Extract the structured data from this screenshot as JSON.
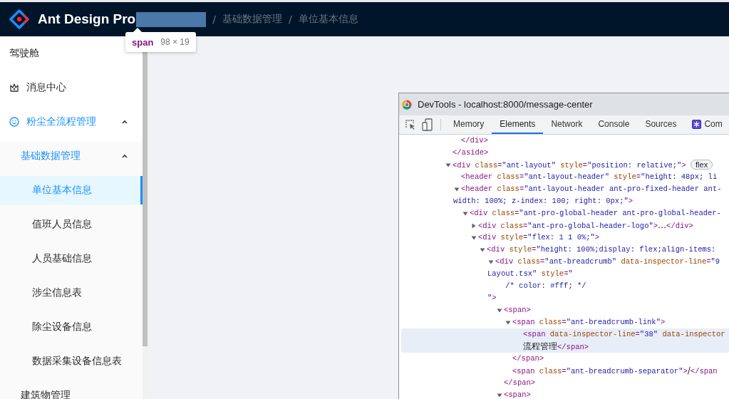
{
  "header": {
    "title": "Ant Design Pro",
    "breadcrumb": [
      {
        "label": "基础数据管理"
      },
      {
        "label": "单位基本信息"
      }
    ],
    "separator": "/"
  },
  "inspector_tooltip": {
    "tag": "span",
    "size": "98 × 19"
  },
  "sidebar": {
    "items": [
      {
        "label": "驾驶舱",
        "selected": false
      },
      {
        "label": "消息中心",
        "selected": false
      },
      {
        "label": "粉尘全流程管理",
        "expanded": true,
        "selected": false,
        "children": [
          {
            "label": "基础数据管理",
            "expanded": true,
            "selected": false,
            "children": [
              {
                "label": "单位基本信息",
                "selected": true
              },
              {
                "label": "值班人员信息",
                "selected": false
              },
              {
                "label": "人员基础信息",
                "selected": false
              },
              {
                "label": "涉尘信息表",
                "selected": false
              },
              {
                "label": "除尘设备信息",
                "selected": false
              },
              {
                "label": "数据采集设备信息表",
                "selected": false
              }
            ]
          },
          {
            "label": "建筑物管理",
            "selected": false
          }
        ]
      }
    ]
  },
  "devtools": {
    "title": "DevTools - localhost:8000/message-center",
    "tabs": [
      {
        "label": "Memory",
        "selected": false
      },
      {
        "label": "Elements",
        "selected": true
      },
      {
        "label": "Network",
        "selected": false
      },
      {
        "label": "Console",
        "selected": false
      },
      {
        "label": "Sources",
        "selected": false
      },
      {
        "label": "Com",
        "kind": "extension",
        "selected": false
      }
    ],
    "tree": [
      {
        "children": [
          {
            "close": [
              {
                "kind": "tag",
                "text": "</div>"
              }
            ]
          }
        ],
        "close": [
          {
            "kind": "tag",
            "text": "</aside>"
          }
        ]
      },
      {
        "open": [
          {
            "kind": "tag",
            "text": "<div"
          },
          {
            "kind": "attr",
            "text": " class"
          },
          {
            "kind": "tag",
            "text": "="
          },
          {
            "kind": "value",
            "text": "\"ant-layout\""
          },
          {
            "kind": "attr",
            "text": " style"
          },
          {
            "kind": "tag",
            "text": "="
          },
          {
            "kind": "value",
            "text": "\"position: relative;\""
          },
          {
            "kind": "tag",
            "text": ">"
          }
        ],
        "badge": "flex",
        "expanded": true,
        "children": [
          {
            "open": [
              {
                "kind": "tag",
                "text": "<header"
              },
              {
                "kind": "attr",
                "text": " class"
              },
              {
                "kind": "tag",
                "text": "="
              },
              {
                "kind": "value",
                "text": "\"ant-layout-header\""
              },
              {
                "kind": "attr",
                "text": " style"
              },
              {
                "kind": "tag",
                "text": "="
              },
              {
                "kind": "value",
                "text": "\"height: 48px; li"
              }
            ]
          },
          {
            "open": [
              {
                "kind": "tag",
                "text": "<header"
              },
              {
                "kind": "attr",
                "text": " class"
              },
              {
                "kind": "tag",
                "text": "="
              },
              {
                "kind": "value",
                "text": "\"ant-layout-header ant-pro-fixed-header ant-"
              }
            ],
            "wrap": [
              [
                {
                  "kind": "value",
                  "text": "width: 100%; z-index: 100; right: 0px;\""
                },
                {
                  "kind": "tag",
                  "text": ">"
                }
              ]
            ],
            "expanded": true,
            "children": [
              {
                "open": [
                  {
                    "kind": "tag",
                    "text": "<div"
                  },
                  {
                    "kind": "attr",
                    "text": " class"
                  },
                  {
                    "kind": "tag",
                    "text": "="
                  },
                  {
                    "kind": "value",
                    "text": "\"ant-pro-global-header ant-pro-global-header-"
                  }
                ],
                "expanded": true,
                "children": [
                  {
                    "open": [
                      {
                        "kind": "tag",
                        "text": "<div"
                      },
                      {
                        "kind": "attr",
                        "text": " class"
                      },
                      {
                        "kind": "tag",
                        "text": "="
                      },
                      {
                        "kind": "value",
                        "text": "\"ant-pro-global-header-logo\""
                      },
                      {
                        "kind": "tag",
                        "text": ">"
                      },
                      {
                        "kind": "text",
                        "text": "…"
                      },
                      {
                        "kind": "tag",
                        "text": "</div>"
                      }
                    ],
                    "expanded": false
                  },
                  {
                    "open": [
                      {
                        "kind": "tag",
                        "text": "<div"
                      },
                      {
                        "kind": "attr",
                        "text": " style"
                      },
                      {
                        "kind": "tag",
                        "text": "="
                      },
                      {
                        "kind": "value",
                        "text": "\"flex: 1 1 0%;\""
                      },
                      {
                        "kind": "tag",
                        "text": ">"
                      }
                    ],
                    "expanded": true,
                    "children": [
                      {
                        "open": [
                          {
                            "kind": "tag",
                            "text": "<div"
                          },
                          {
                            "kind": "attr",
                            "text": " style"
                          },
                          {
                            "kind": "tag",
                            "text": "="
                          },
                          {
                            "kind": "value",
                            "text": "\"height: 100%;display: flex;align-items:"
                          }
                        ],
                        "expanded": true,
                        "children": [
                          {
                            "open": [
                              {
                                "kind": "tag",
                                "text": "<div"
                              },
                              {
                                "kind": "attr",
                                "text": " class"
                              },
                              {
                                "kind": "tag",
                                "text": "="
                              },
                              {
                                "kind": "value",
                                "text": "\"ant-breadcrumb\""
                              },
                              {
                                "kind": "attr",
                                "text": " data-inspector-line"
                              },
                              {
                                "kind": "tag",
                                "text": "="
                              },
                              {
                                "kind": "value",
                                "text": "\"9"
                              }
                            ],
                            "wrap": [
                              [
                                {
                                  "kind": "value",
                                  "text": "Layout.tsx\""
                                },
                                {
                                  "kind": "attr",
                                  "text": " style"
                                },
                                {
                                  "kind": "tag",
                                  "text": "="
                                },
                                {
                                  "kind": "value",
                                  "text": "\""
                                }
                              ],
                              [
                                {
                                  "kind": "value",
                                  "text": "    /* color: #fff; */"
                                }
                              ],
                              [
                                {
                                  "kind": "value",
                                  "text": "\""
                                },
                                {
                                  "kind": "tag",
                                  "text": ">"
                                }
                              ]
                            ],
                            "expanded": true,
                            "children": [
                              {
                                "open": [
                                  {
                                    "kind": "tag",
                                    "text": "<span>"
                                  }
                                ],
                                "expanded": true,
                                "children": [
                                  {
                                    "open": [
                                      {
                                        "kind": "tag",
                                        "text": "<span"
                                      },
                                      {
                                        "kind": "attr",
                                        "text": " class"
                                      },
                                      {
                                        "kind": "tag",
                                        "text": "="
                                      },
                                      {
                                        "kind": "value",
                                        "text": "\"ant-breadcrumb-link\""
                                      },
                                      {
                                        "kind": "tag",
                                        "text": ">"
                                      }
                                    ],
                                    "expanded": true,
                                    "children": [
                                      {
                                        "open": [
                                          {
                                            "kind": "tag",
                                            "text": "<span"
                                          },
                                          {
                                            "kind": "attr",
                                            "text": " data-inspector-line"
                                          },
                                          {
                                            "kind": "tag",
                                            "text": "="
                                          },
                                          {
                                            "kind": "value",
                                            "text": "\"38\""
                                          },
                                          {
                                            "kind": "attr",
                                            "text": " data-inspector"
                                          }
                                        ],
                                        "wrap": [
                                          [
                                            {
                                              "kind": "text",
                                              "text": "流程管理"
                                            },
                                            {
                                              "kind": "tag",
                                              "text": "</span>"
                                            }
                                          ]
                                        ],
                                        "selected": true
                                      }
                                    ],
                                    "close": [
                                      {
                                        "kind": "tag",
                                        "text": "</span>"
                                      }
                                    ]
                                  },
                                  {
                                    "open": [
                                      {
                                        "kind": "tag",
                                        "text": "<span"
                                      },
                                      {
                                        "kind": "attr",
                                        "text": " class"
                                      },
                                      {
                                        "kind": "tag",
                                        "text": "="
                                      },
                                      {
                                        "kind": "value",
                                        "text": "\"ant-breadcrumb-separator\""
                                      },
                                      {
                                        "kind": "tag",
                                        "text": ">"
                                      },
                                      {
                                        "kind": "text",
                                        "text": "/"
                                      },
                                      {
                                        "kind": "tag",
                                        "text": "</span"
                                      }
                                    ]
                                  }
                                ],
                                "close": [
                                  {
                                    "kind": "tag",
                                    "text": "</span>"
                                  }
                                ]
                              },
                              {
                                "open": [
                                  {
                                    "kind": "tag",
                                    "text": "<span>"
                                  }
                                ],
                                "expanded": true
                              }
                            ]
                          }
                        ]
                      }
                    ]
                  }
                ]
              }
            ]
          }
        ]
      }
    ]
  }
}
